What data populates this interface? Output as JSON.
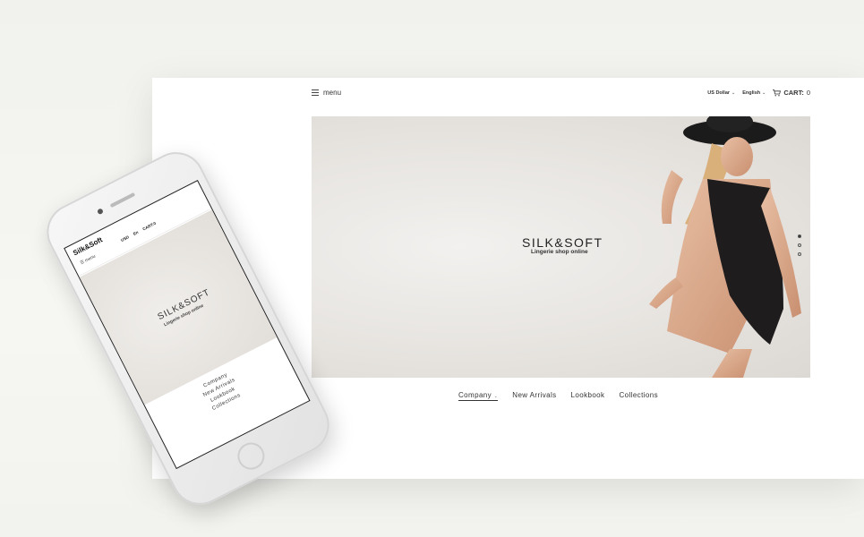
{
  "desktop": {
    "menu_label": "menu",
    "currency": "US Dollar",
    "language": "English",
    "cart_label": "CART:",
    "cart_count": "0",
    "hero_title": "SILK&SOFT",
    "hero_subtitle": "Lingerie shop online",
    "nav": [
      "Company",
      "New Arrivals",
      "Lookbook",
      "Collections"
    ],
    "slides_count": 3,
    "active_slide": 1
  },
  "phone": {
    "logo": "Silk&Soft",
    "menu_label": "menu",
    "currency": "USD",
    "language": "En",
    "cart_label": "CART:",
    "cart_count": "0",
    "hero_title": "SILK&SOFT",
    "hero_subtitle": "Lingerie shop online",
    "nav": [
      "Company",
      "New Arrivals",
      "Lookbook",
      "Collections"
    ]
  }
}
